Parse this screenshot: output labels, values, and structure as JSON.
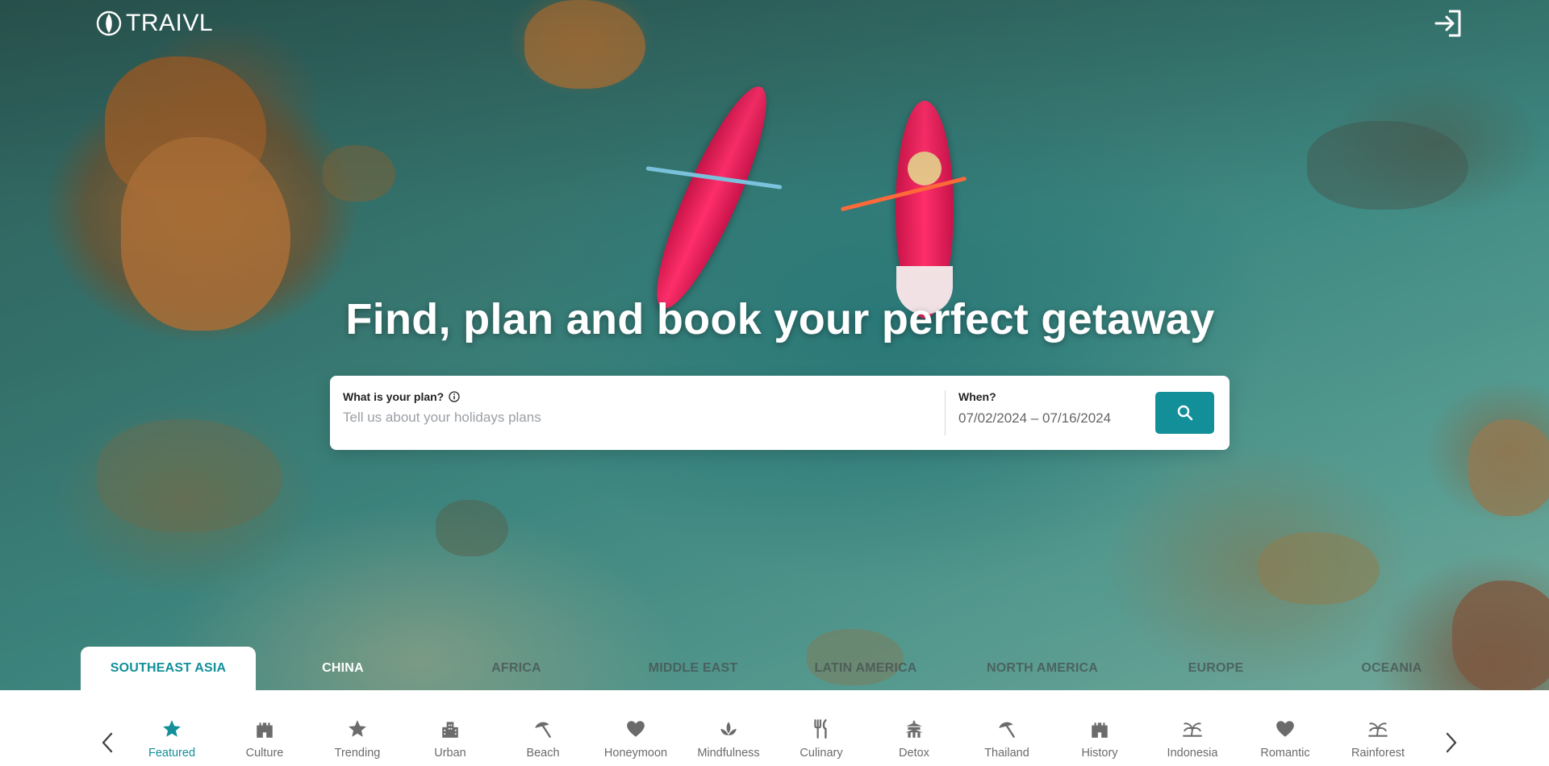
{
  "brand": {
    "name": "TRAIVL"
  },
  "hero": {
    "headline": "Find, plan and book your perfect getaway"
  },
  "search": {
    "plan_label": "What is your plan?",
    "plan_placeholder": "Tell us about your holidays plans",
    "when_label": "When?",
    "when_value": "07/02/2024 – 07/16/2024"
  },
  "regions": [
    {
      "label": "SOUTHEAST ASIA",
      "active": true
    },
    {
      "label": "CHINA",
      "active": false
    },
    {
      "label": "AFRICA",
      "active": false
    },
    {
      "label": "MIDDLE EAST",
      "active": false
    },
    {
      "label": "LATIN AMERICA",
      "active": false
    },
    {
      "label": "NORTH AMERICA",
      "active": false
    },
    {
      "label": "EUROPE",
      "active": false
    },
    {
      "label": "OCEANIA",
      "active": false
    }
  ],
  "categories": [
    {
      "label": "Featured",
      "icon": "star-icon",
      "active": true
    },
    {
      "label": "Culture",
      "icon": "castle-icon",
      "active": false
    },
    {
      "label": "Trending",
      "icon": "star-icon",
      "active": false
    },
    {
      "label": "Urban",
      "icon": "city-icon",
      "active": false
    },
    {
      "label": "Beach",
      "icon": "beach-umbrella-icon",
      "active": false
    },
    {
      "label": "Honeymoon",
      "icon": "heart-icon",
      "active": false
    },
    {
      "label": "Mindfulness",
      "icon": "lotus-icon",
      "active": false
    },
    {
      "label": "Culinary",
      "icon": "fork-knife-icon",
      "active": false
    },
    {
      "label": "Detox",
      "icon": "temple-icon",
      "active": false
    },
    {
      "label": "Thailand",
      "icon": "beach-umbrella-icon",
      "active": false
    },
    {
      "label": "History",
      "icon": "castle-icon",
      "active": false
    },
    {
      "label": "Indonesia",
      "icon": "palm-icon",
      "active": false
    },
    {
      "label": "Romantic",
      "icon": "heart-icon",
      "active": false
    },
    {
      "label": "Rainforest",
      "icon": "palm-icon",
      "active": false
    }
  ],
  "colors": {
    "accent": "#128f99",
    "inactive_icon": "#6b6b6b"
  }
}
